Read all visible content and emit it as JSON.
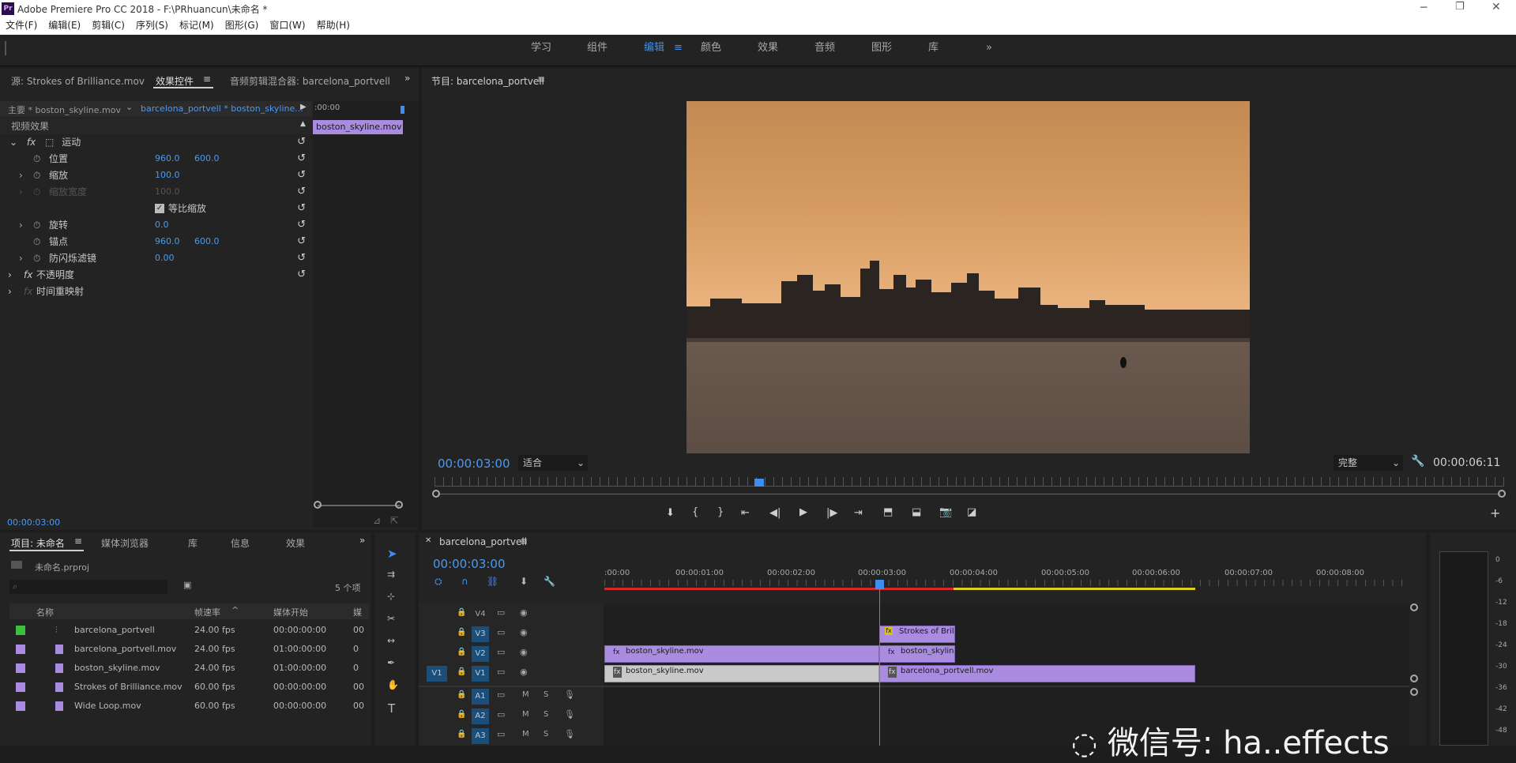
{
  "window": {
    "title": "Adobe Premiere Pro CC 2018 - F:\\PRhuancun\\未命名 *",
    "app_icon": "Pr"
  },
  "menu": [
    "文件(F)",
    "编辑(E)",
    "剪辑(C)",
    "序列(S)",
    "标记(M)",
    "图形(G)",
    "窗口(W)",
    "帮助(H)"
  ],
  "workspaces": [
    "学习",
    "组件",
    "编辑",
    "颜色",
    "效果",
    "音频",
    "图形",
    "库"
  ],
  "active_workspace": "编辑",
  "effect_panel": {
    "tabs": [
      "源: Strokes of Brilliance.mov",
      "效果控件",
      "音频剪辑混合器: barcelona_portvell"
    ],
    "master": "主要 * boston_skyline.mov",
    "clip": "barcelona_portvell * boston_skyline...",
    "timecode_head": ":00:00",
    "clip_label": "boston_skyline.mov",
    "section": "视频效果",
    "motion": "运动",
    "position_label": "位置",
    "position_x": "960.0",
    "position_y": "600.0",
    "scale_label": "缩放",
    "scale_value": "100.0",
    "scale_width_label": "缩放宽度",
    "scale_width_value": "100.0",
    "uniform_label": "等比缩放",
    "rotation_label": "旋转",
    "rotation_value": "0.0",
    "anchor_label": "锚点",
    "anchor_x": "960.0",
    "anchor_y": "600.0",
    "flicker_label": "防闪烁滤镜",
    "flicker_value": "0.00",
    "opacity_label": "不透明度",
    "remap_label": "时间重映射",
    "timecode": "00:00:03:00"
  },
  "program": {
    "title": "节目: barcelona_portvell",
    "timecode": "00:00:03:00",
    "fit": "适合",
    "quality": "完整",
    "duration": "00:00:06:11"
  },
  "project": {
    "tabs": [
      "项目: 未命名",
      "媒体浏览器",
      "库",
      "信息",
      "效果"
    ],
    "file": "未命名.prproj",
    "count": "5 个项",
    "headers": [
      "名称",
      "帧速率",
      "媒体开始",
      "媒"
    ],
    "items": [
      {
        "name": "barcelona_portvell",
        "fps": "24.00 fps",
        "start": "00:00:00:00",
        "more": "00",
        "color": "#3fbf3f"
      },
      {
        "name": "barcelona_portvell.mov",
        "fps": "24.00 fps",
        "start": "01:00:00:00",
        "more": "0",
        "color": "#a98ce0"
      },
      {
        "name": "boston_skyline.mov",
        "fps": "24.00 fps",
        "start": "01:00:00:00",
        "more": "0",
        "color": "#a98ce0"
      },
      {
        "name": "Strokes of Brilliance.mov",
        "fps": "60.00 fps",
        "start": "00:00:00:00",
        "more": "00",
        "color": "#a98ce0"
      },
      {
        "name": "Wide Loop.mov",
        "fps": "60.00 fps",
        "start": "00:00:00:00",
        "more": "00",
        "color": "#a98ce0"
      }
    ]
  },
  "timeline": {
    "tab": "barcelona_portvell",
    "timecode": "00:00:03:00",
    "ruler": [
      ":00:00",
      "00:00:01:00",
      "00:00:02:00",
      "00:00:03:00",
      "00:00:04:00",
      "00:00:05:00",
      "00:00:06:00",
      "00:00:07:00",
      "00:00:08:00"
    ],
    "tracks": [
      "V4",
      "V3",
      "V2",
      "V1",
      "A1",
      "A2",
      "A3"
    ],
    "src_v1": "V1",
    "m": "M",
    "s": "S",
    "clips": {
      "v3": "Strokes of Brillia",
      "v2a": "boston_skyline.mov",
      "v2b": "boston_skyline.m",
      "v1a": "boston_skyline.mov",
      "v1b": "barcelona_portvell.mov"
    }
  },
  "meter": [
    "0",
    "-6",
    "-12",
    "-18",
    "-24",
    "-30",
    "-36",
    "-42",
    "-48"
  ],
  "watermark": "微信号: ha..effects"
}
